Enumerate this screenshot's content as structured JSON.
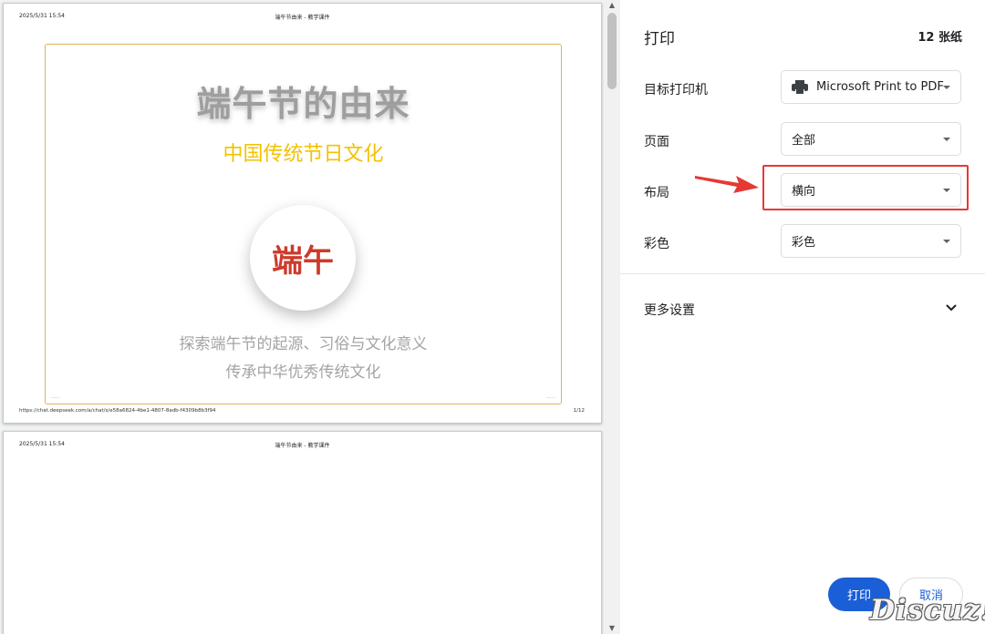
{
  "preview": {
    "page1": {
      "header_date": "2025/5/31 15:54",
      "header_title": "端午节由来 - 教学课件",
      "slide_title": "端午节的由来",
      "slide_subtitle": "中国传统节日文化",
      "badge_text": "端午",
      "line1": "探索端午节的起源、习俗与文化意义",
      "line2": "传承中华优秀传统文化",
      "footer_url": "https://chat.deepseek.com/a/chat/s/e58a6824-4be1-4807-8adb-f4309b8b3f94",
      "footer_page": "1/12"
    },
    "page2": {
      "header_date": "2025/5/31 15:54",
      "header_title": "端午节由来 - 教学课件"
    }
  },
  "panel": {
    "title": "打印",
    "sheet_count": "12 张纸",
    "rows": {
      "printer": {
        "label": "目标打印机",
        "value": "Microsoft Print to PDF",
        "icon": "printer-icon"
      },
      "pages": {
        "label": "页面",
        "value": "全部"
      },
      "layout": {
        "label": "布局",
        "value": "横向"
      },
      "color": {
        "label": "彩色",
        "value": "彩色"
      }
    },
    "more_settings": "更多设置",
    "print_button": "打印",
    "cancel_button": "取消"
  },
  "watermark": "Discuz!",
  "colors": {
    "accent": "#1a5fd7",
    "highlight": "#e53935",
    "slide_border": "#e0b060",
    "subtitle": "#f2c200",
    "badge_text": "#cc3b2b"
  }
}
